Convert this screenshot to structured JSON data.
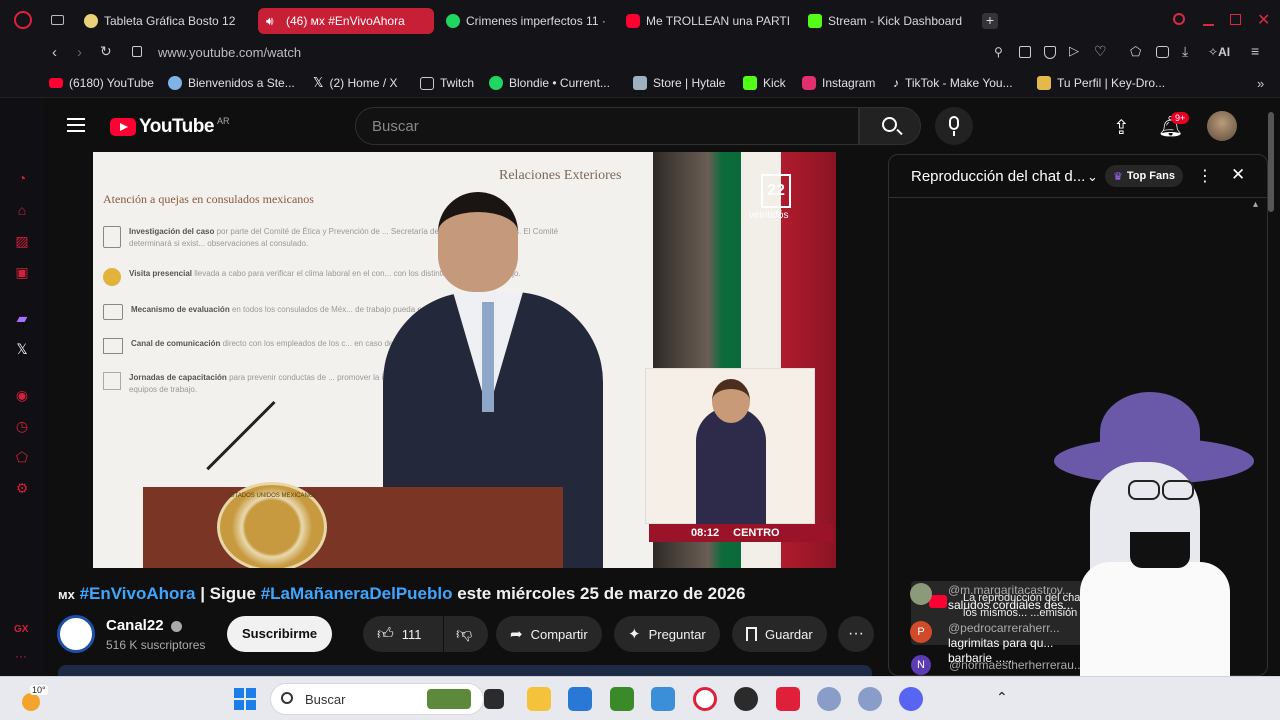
{
  "browser": {
    "tabs": [
      {
        "label": "Tableta Gráfica Bosto 12",
        "icon": "bosto-icon",
        "color": "#e8d27a"
      },
      {
        "label": "(46) ᴍx #EnVivoAhora",
        "icon": "youtube-icon",
        "color": "#ff0033",
        "active": true
      },
      {
        "label": "Crimenes imperfectos 11 ·",
        "icon": "spotify-icon",
        "color": "#1ed760"
      },
      {
        "label": "Me TROLLEAN una PARTI",
        "icon": "youtube-icon",
        "color": "#ff0033"
      },
      {
        "label": "Stream - Kick Dashboard",
        "icon": "kick-icon",
        "color": "#53fc18"
      }
    ],
    "url": "www.youtube.com/watch",
    "ai_label": "AI",
    "bookmarks": [
      {
        "label": "(6180) YouTube",
        "icon": "youtube-icon",
        "color": "#ff0033"
      },
      {
        "label": "Bienvenidos a Ste...",
        "icon": "steam-icon",
        "color": "#7fb3e6"
      },
      {
        "label": "(2) Home / X",
        "icon": "x-icon",
        "color": "#ffffff"
      },
      {
        "label": "Twitch",
        "icon": "page-icon",
        "color": "#cccccc"
      },
      {
        "label": "Blondie • Current...",
        "icon": "spotify-icon",
        "color": "#1ed760"
      },
      {
        "label": "Store | Hytale",
        "icon": "hytale-icon",
        "color": "#9fb0c0"
      },
      {
        "label": "Kick",
        "icon": "kick-icon",
        "color": "#53fc18"
      },
      {
        "label": "Instagram",
        "icon": "instagram-icon",
        "color": "#e1306c"
      },
      {
        "label": "TikTok - Make You...",
        "icon": "tiktok-icon",
        "color": "#ffffff"
      },
      {
        "label": "Tu Perfil | Key-Dro...",
        "icon": "keydrop-icon",
        "color": "#e5b84a"
      }
    ],
    "rail_label": "GX"
  },
  "youtube": {
    "logo_text": "YouTube",
    "region": "AR",
    "search_placeholder": "Buscar",
    "notif_badge": "9+",
    "video": {
      "slide_header": "Relaciones Exteriores",
      "slide_title": "Atención a quejas en consulados mexicanos",
      "slide_items": [
        {
          "bold": "Investigación del caso",
          "text": "por parte del Comité de Ética y Prevención de ... Secretaría de Relaciones Exteriores. El Comité determinará si exist... observaciones al consulado."
        },
        {
          "bold": "Visita presencial",
          "text": "llevada a cabo para verificar el clima laboral en el con... con los distintos equipos de trabajo."
        },
        {
          "bold": "Mecanismo de evaluación",
          "text": "en todos los consulados de Méx... de trabajo pueda evaluar a los encargados de cada are..."
        },
        {
          "bold": "Canal de comunicación",
          "text": "directo con los empleados de los c... en caso de que requieran plantear inconformidades."
        },
        {
          "bold": "Jornadas de capacitación",
          "text": "para prevenir conductas de ... promover la igualdad de género y tener mejores herram... coordinar equipos de trabajo."
        }
      ],
      "channel_bug_number": "22",
      "channel_bug_text": "veintidós",
      "time": "08:12",
      "zone": "CENTRO",
      "seal_text": "ESTADOS UNIDOS MEXICANOS"
    },
    "title_prefix": "ᴍx",
    "title_tag1": "#EnVivoAhora",
    "title_mid": " | Sigue ",
    "title_tag2": "#LaMañaneraDelPueblo",
    "title_end": " este miércoles 25 de marzo de 2026",
    "channel_name": "Canal22",
    "subscribers": "516 K suscriptores",
    "subscribe_label": "Suscribirme",
    "likes": "111",
    "share_label": "Compartir",
    "ask_label": "Preguntar",
    "save_label": "Guardar",
    "chat": {
      "title": "Reproducción del chat d...",
      "top_fans": "Top Fans",
      "notice": "La reproducción del chat e... ...ada. Se mostrarán los mismos... ...emisión en directo.",
      "messages": [
        {
          "initial": "N",
          "color": "#5c3bb5",
          "author": "@normaestherherrerau...",
          "text": ""
        },
        {
          "initial": "",
          "color": "#8a9a7a",
          "author": "@m.margaritacastrov...",
          "text": "saludos cordiales des..."
        },
        {
          "initial": "P",
          "color": "#d14a2a",
          "author": "@pedrocarreraherr...",
          "text": "lagrimitas para qu... barbarie ....."
        }
      ]
    }
  },
  "taskbar": {
    "weather_temp": "10°",
    "search_placeholder": "Buscar"
  }
}
